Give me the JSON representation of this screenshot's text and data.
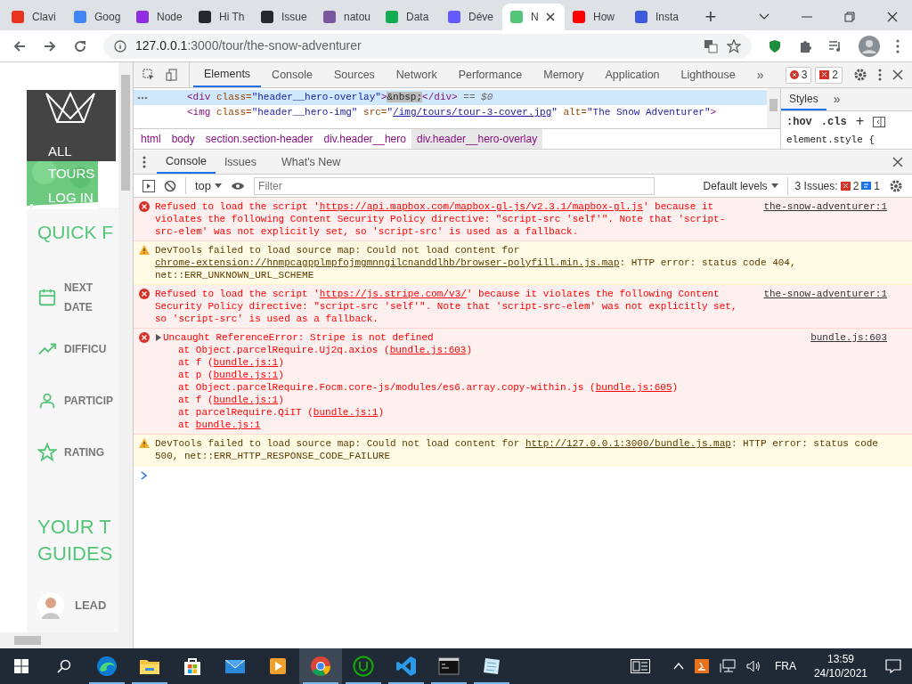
{
  "browser": {
    "tabs": [
      {
        "title": "Clavi",
        "color": "#e8341c",
        "selected": false
      },
      {
        "title": "Goog",
        "color": "#4285f4",
        "selected": false
      },
      {
        "title": "Node",
        "color": "#8e2de2",
        "selected": false
      },
      {
        "title": "Hi Th",
        "color": "#24292e",
        "selected": false
      },
      {
        "title": "Issue",
        "color": "#24292e",
        "selected": false
      },
      {
        "title": "natou",
        "color": "#79589f",
        "selected": false
      },
      {
        "title": "Data",
        "color": "#13aa52",
        "selected": false
      },
      {
        "title": "Déve",
        "color": "#635bff",
        "selected": false
      },
      {
        "title": "N",
        "color": "#55c57a",
        "selected": true
      },
      {
        "title": "How",
        "color": "#ff0000",
        "selected": false
      },
      {
        "title": "Insta",
        "color": "#3b5bdb",
        "selected": false
      }
    ],
    "new_tab": "+",
    "address_bar": {
      "host": "127.0.0.1",
      "path": ":3000/tour/the-snow-adventurer"
    }
  },
  "page": {
    "nav": [
      "ALL TOURS",
      "LOG IN"
    ],
    "quick_facts_title": "QUICK F",
    "facts": [
      {
        "kind": "calendar",
        "label": "NEXT DATE"
      },
      {
        "kind": "trend",
        "label": "DIFFICU"
      },
      {
        "kind": "user",
        "label": "PARTICIP"
      },
      {
        "kind": "star",
        "label": "RATING"
      }
    ],
    "guides_title": [
      "YOUR T",
      "GUIDES"
    ],
    "guide_role": "LEAD"
  },
  "devtools": {
    "tabs": [
      {
        "label": "Elements",
        "selected": true
      },
      {
        "label": "Console",
        "selected": false
      },
      {
        "label": "Sources",
        "selected": false
      },
      {
        "label": "Network",
        "selected": false
      },
      {
        "label": "Performance",
        "selected": false
      },
      {
        "label": "Memory",
        "selected": false
      },
      {
        "label": "Application",
        "selected": false
      },
      {
        "label": "Lighthouse",
        "selected": false
      }
    ],
    "more": "»",
    "error_count": "3",
    "issue_count": "2",
    "dom_lines": [
      {
        "selected": true,
        "segments": [
          {
            "kind": "tag",
            "text": "<div"
          },
          {
            "kind": "attr",
            "text": " class="
          },
          {
            "kind": "value",
            "text": "\"header__hero-overlay\""
          },
          {
            "kind": "tag",
            "text": ">"
          },
          {
            "kind": "marked",
            "text": "&nbsp;"
          },
          {
            "kind": "tag",
            "text": "</div>"
          },
          {
            "kind": "meta",
            "text": " == $0"
          }
        ]
      },
      {
        "selected": false,
        "segments": [
          {
            "kind": "tag",
            "text": "<img"
          },
          {
            "kind": "attr",
            "text": " class="
          },
          {
            "kind": "value",
            "text": "\"header__hero-img\""
          },
          {
            "kind": "attr",
            "text": " src="
          },
          {
            "kind": "value",
            "text": "\""
          },
          {
            "kind": "link",
            "text": "/img/tours/tour-3-cover.jpg"
          },
          {
            "kind": "value",
            "text": "\""
          },
          {
            "kind": "attr",
            "text": " alt="
          },
          {
            "kind": "value",
            "text": "\"The Snow Adventurer\""
          },
          {
            "kind": "tag",
            "text": ">"
          }
        ]
      }
    ],
    "breadcrumbs": [
      {
        "text": "html",
        "selected": false
      },
      {
        "text": "body",
        "selected": false
      },
      {
        "text": "section.section-header",
        "selected": false
      },
      {
        "text": "div.header__hero",
        "selected": false
      },
      {
        "text": "div.header__hero-overlay",
        "selected": true
      }
    ],
    "styles": {
      "tabs": [
        {
          "label": "Styles",
          "selected": true
        }
      ],
      "more": "»",
      "hov": ":hov",
      "cls": ".cls",
      "plus": "+",
      "rule": "element.style {"
    },
    "drawer_tabs": [
      {
        "label": "Console",
        "selected": true
      },
      {
        "label": "Issues",
        "selected": false
      },
      {
        "label": "What's New",
        "selected": false
      }
    ],
    "console_toolbar": {
      "context": "top",
      "filter_placeholder": "Filter",
      "levels": "Default levels",
      "issues_label": "3 Issues:",
      "issue_errors": "2",
      "issue_infos": "1"
    },
    "messages": [
      {
        "kind": "error",
        "source": "the-snow-adventurer:1",
        "segments": [
          {
            "text": "Refused to load the script '"
          },
          {
            "text": "https://api.mapbox.com/mapbox-gl-js/v2.3.1/mapbox-gl.js",
            "link": true
          },
          {
            "text": "' because it violates the following Content Security Policy directive: \"script-src 'self'\". Note that 'script-src-elem' was not explicitly set, so 'script-src' is used as a fallback."
          }
        ]
      },
      {
        "kind": "warning",
        "segments": [
          {
            "text": "DevTools failed to load source map: Could not load content for "
          },
          {
            "text": "chrome-extension://hnmpcagpplmpfojmgmnngilcnanddlhb/browser-polyfill.min.js.map",
            "link": true
          },
          {
            "text": ": HTTP error: status code 404, net::ERR_UNKNOWN_URL_SCHEME"
          }
        ]
      },
      {
        "kind": "error",
        "source": "the-snow-adventurer:1",
        "segments": [
          {
            "text": "Refused to load the script '"
          },
          {
            "text": "https://js.stripe.com/v3/",
            "link": true
          },
          {
            "text": "' because it violates the following Content Security Policy directive: \"script-src 'self'\". Note that 'script-src-elem' was not explicitly set, so 'script-src' is used as a fallback."
          }
        ]
      },
      {
        "kind": "error",
        "source": "bundle.js:603",
        "expanded": false,
        "segments": [
          {
            "text": "Uncaught ReferenceError: Stripe is not defined"
          }
        ],
        "stack": [
          [
            {
              "text": "at Object.parcelRequire.Uj2q.axios ("
            },
            {
              "text": "bundle.js:603",
              "link": true
            },
            {
              "text": ")"
            }
          ],
          [
            {
              "text": "at f ("
            },
            {
              "text": "bundle.js:1",
              "link": true
            },
            {
              "text": ")"
            }
          ],
          [
            {
              "text": "at p ("
            },
            {
              "text": "bundle.js:1",
              "link": true
            },
            {
              "text": ")"
            }
          ],
          [
            {
              "text": "at Object.parcelRequire.Focm.core-js/modules/es6.array.copy-within.js ("
            },
            {
              "text": "bundle.js:605",
              "link": true
            },
            {
              "text": ")"
            }
          ],
          [
            {
              "text": "at f ("
            },
            {
              "text": "bundle.js:1",
              "link": true
            },
            {
              "text": ")"
            }
          ],
          [
            {
              "text": "at parcelRequire.QiIT ("
            },
            {
              "text": "bundle.js:1",
              "link": true
            },
            {
              "text": ")"
            }
          ],
          [
            {
              "text": "at "
            },
            {
              "text": "bundle.js:1",
              "link": true
            }
          ]
        ]
      },
      {
        "kind": "warning",
        "segments": [
          {
            "text": "DevTools failed to load source map: Could not load content for "
          },
          {
            "text": "http://127.0.0.1:3000/bundle.js.map",
            "link": true
          },
          {
            "text": ": HTTP error: status code 500, net::ERR_HTTP_RESPONSE_CODE_FAILURE"
          }
        ]
      }
    ]
  },
  "taskbar": {
    "apps": [
      {
        "kind": "edge",
        "open": true,
        "selected": false
      },
      {
        "kind": "folder",
        "open": true,
        "selected": false
      },
      {
        "kind": "store",
        "open": false,
        "selected": false
      },
      {
        "kind": "mail",
        "open": false,
        "selected": false
      },
      {
        "kind": "media",
        "open": false,
        "selected": false
      },
      {
        "kind": "chrome",
        "open": true,
        "selected": true
      },
      {
        "kind": "ring",
        "open": true,
        "selected": false
      },
      {
        "kind": "code",
        "open": true,
        "selected": false
      },
      {
        "kind": "terminal",
        "open": true,
        "selected": false
      },
      {
        "kind": "notepad",
        "open": true,
        "selected": false
      }
    ],
    "language": "FRA",
    "time": "13:59",
    "date": "24/10/2021"
  }
}
